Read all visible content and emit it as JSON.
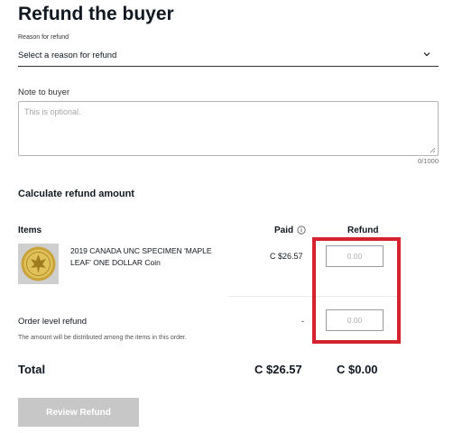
{
  "header": {
    "title": "Refund the buyer"
  },
  "reason": {
    "label": "Reason for refund",
    "selected": "Select a reason for refund"
  },
  "note": {
    "label": "Note to buyer",
    "placeholder": "This is optional.",
    "counter": "0/1000"
  },
  "calculate": {
    "heading": "Calculate refund amount"
  },
  "columns": {
    "items": "Items",
    "paid": "Paid",
    "refund": "Refund"
  },
  "item": {
    "title": "2019 CANADA UNC SPECIMEN 'MAPLE LEAF' ONE DOLLAR Coin",
    "paid": "C $26.57",
    "refund_placeholder": "0.00"
  },
  "order_level": {
    "label": "Order level refund",
    "paid": "-",
    "refund_placeholder": "0.00",
    "note": "The amount will be distributed among the items in this order."
  },
  "totals": {
    "label": "Total",
    "paid": "C $26.57",
    "refund": "C $0.00"
  },
  "actions": {
    "review_label": "Review Refund"
  },
  "icons": {
    "chevron": "chevron-down-icon",
    "info": "info-icon",
    "coin": "coin-thumbnail"
  },
  "colors": {
    "highlight": "#d4232e",
    "button_disabled": "#c7c7c7"
  }
}
